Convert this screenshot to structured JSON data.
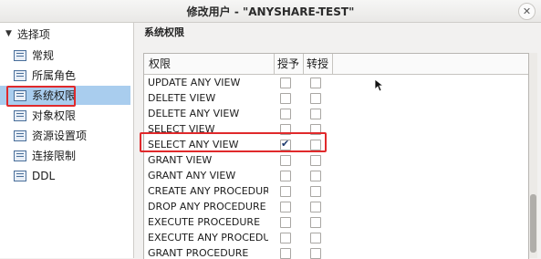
{
  "window": {
    "title": "修改用户 - \"ANYSHARE-TEST\""
  },
  "sidebar": {
    "header": "选择项",
    "items": [
      {
        "label": "常规",
        "selected": false
      },
      {
        "label": "所属角色",
        "selected": false
      },
      {
        "label": "系统权限",
        "selected": true
      },
      {
        "label": "对象权限",
        "selected": false
      },
      {
        "label": "资源设置项",
        "selected": false
      },
      {
        "label": "连接限制",
        "selected": false
      },
      {
        "label": "DDL",
        "selected": false
      }
    ]
  },
  "main": {
    "title": "系统权限",
    "columns": {
      "name": "权限",
      "grant": "授予",
      "transfer": "转授"
    },
    "rows": [
      {
        "name": "UPDATE ANY VIEW",
        "grant": false,
        "transfer": false
      },
      {
        "name": "DELETE VIEW",
        "grant": false,
        "transfer": false
      },
      {
        "name": "DELETE ANY VIEW",
        "grant": false,
        "transfer": false
      },
      {
        "name": "SELECT VIEW",
        "grant": false,
        "transfer": false
      },
      {
        "name": "SELECT ANY VIEW",
        "grant": true,
        "transfer": false,
        "highlighted": true
      },
      {
        "name": "GRANT VIEW",
        "grant": false,
        "transfer": false
      },
      {
        "name": "GRANT ANY VIEW",
        "grant": false,
        "transfer": false
      },
      {
        "name": "CREATE ANY PROCEDURE",
        "grant": false,
        "transfer": false
      },
      {
        "name": "DROP ANY PROCEDURE",
        "grant": false,
        "transfer": false
      },
      {
        "name": "EXECUTE PROCEDURE",
        "grant": false,
        "transfer": false
      },
      {
        "name": "EXECUTE ANY PROCEDURE",
        "grant": false,
        "transfer": false
      },
      {
        "name": "GRANT PROCEDURE",
        "grant": false,
        "transfer": false
      }
    ]
  },
  "icons": {
    "close": "close-icon",
    "sidebar_item": "document-icon",
    "collapse": "triangle-down-icon",
    "checkbox_checked": "check-icon",
    "cursor": "mouse-pointer-icon"
  },
  "colors": {
    "selection": "#a9cdee",
    "highlight_border": "#e0292b",
    "checkmark": "#1d3a6e"
  }
}
